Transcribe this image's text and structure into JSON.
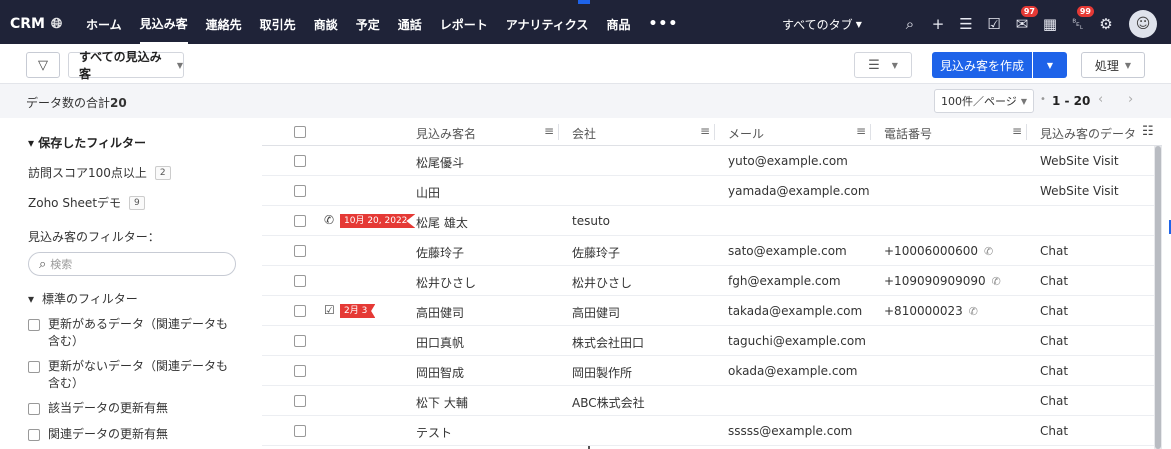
{
  "nav": {
    "brand": "CRM",
    "tabs": [
      "ホーム",
      "見込み客",
      "連絡先",
      "取引先",
      "商談",
      "予定",
      "通話",
      "レポート",
      "アナリティクス",
      "商品"
    ],
    "more": "•••",
    "all_tabs": "すべてのタブ",
    "badge_mail": "97",
    "badge_notify": "99",
    "icons": [
      "search-icon",
      "plus-icon",
      "calendar-stack-icon",
      "checkmark-calendar-icon",
      "mail-icon",
      "calendar-icon",
      "bell-icon",
      "gear-icon"
    ]
  },
  "toolbar": {
    "view": "すべての見込み客",
    "create": "見込み客を作成",
    "action": "処理"
  },
  "subbar": {
    "total_label": "データ数の合計",
    "total_value": "20",
    "per_page": "100件／ページ",
    "range": "1 - 20"
  },
  "sidebar": {
    "saved_filters": "保存したフィルター",
    "saved": [
      {
        "label": "訪問スコア100点以上",
        "count": "2"
      },
      {
        "label": "Zoho Sheetデモ",
        "count": "9"
      }
    ],
    "lead_filters": "見込み客のフィルター：",
    "search_placeholder": "検索",
    "standard_filters": "標準のフィルター",
    "checks": [
      "更新があるデータ（関連データも含む）",
      "更新がないデータ（関連データも含む）",
      "該当データの更新有無",
      "関連データの更新有無"
    ]
  },
  "grid": {
    "headers": {
      "name": "見込み客名",
      "company": "会社",
      "email": "メール",
      "phone": "電話番号",
      "source": "見込み客のデータ元"
    },
    "rows": [
      {
        "name": "松尾優斗",
        "company": "",
        "email": "yuto@example.com",
        "phone": "",
        "source": "WebSite Visit",
        "tag": "",
        "tag_icon": ""
      },
      {
        "name": "山田",
        "company": "",
        "email": "yamada@example.com",
        "phone": "",
        "source": "WebSite Visit",
        "tag": "",
        "tag_icon": ""
      },
      {
        "name": "松尾 雄太",
        "company": "tesuto",
        "email": "",
        "phone": "",
        "source": "",
        "tag": "10月 20, 2022",
        "tag_icon": "phone"
      },
      {
        "name": "佐藤玲子",
        "company": "佐藤玲子",
        "email": "sato@example.com",
        "phone": "+10006000600",
        "source": "Chat",
        "tag": "",
        "tag_icon": ""
      },
      {
        "name": "松井ひさし",
        "company": "松井ひさし",
        "email": "fgh@example.com",
        "phone": "+109090909090",
        "source": "Chat",
        "tag": "",
        "tag_icon": ""
      },
      {
        "name": "高田健司",
        "company": "高田健司",
        "email": "takada@example.com",
        "phone": "+810000023",
        "source": "Chat",
        "tag": "2月 3",
        "tag_icon": "task"
      },
      {
        "name": "田口真帆",
        "company": "株式会社田口",
        "email": "taguchi@example.com",
        "phone": "",
        "source": "Chat",
        "tag": "",
        "tag_icon": ""
      },
      {
        "name": "岡田智成",
        "company": "岡田製作所",
        "email": "okada@example.com",
        "phone": "",
        "source": "Chat",
        "tag": "",
        "tag_icon": ""
      },
      {
        "name": "松下 大輔",
        "company": "ABC株式会社",
        "email": "",
        "phone": "",
        "source": "Chat",
        "tag": "",
        "tag_icon": ""
      },
      {
        "name": "テスト",
        "company": "",
        "email": "sssss@example.com",
        "phone": "",
        "source": "Chat",
        "tag": "",
        "tag_icon": ""
      }
    ]
  }
}
